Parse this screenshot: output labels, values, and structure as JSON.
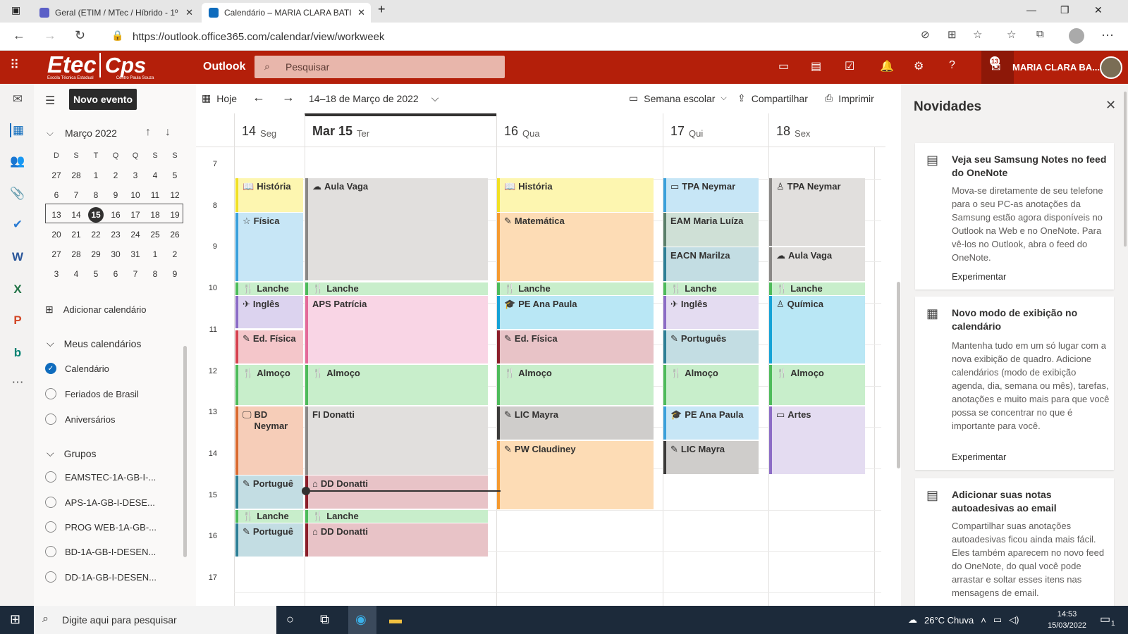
{
  "browser": {
    "tabs": [
      {
        "label": "Geral (ETIM / MTec / Híbrido - 1º",
        "active": false
      },
      {
        "label": "Calendário – MARIA CLARA BATI",
        "active": true
      }
    ],
    "url": "https://outlook.office365.com/calendar/view/workweek"
  },
  "app": {
    "name": "Outlook",
    "logo_text": "Etec",
    "logo_sub": "Escola Técnica Estadual",
    "logo_cps": "Cps",
    "logo_cps_sub": "Centro Paula Souza",
    "search_placeholder": "Pesquisar",
    "user_name": "MARIA CLARA BA...",
    "notif_count": "13"
  },
  "left": {
    "new_event": "Novo evento",
    "month_title": "Março 2022",
    "weekday_headers": [
      "D",
      "S",
      "T",
      "Q",
      "Q",
      "S",
      "S"
    ],
    "weeks": [
      [
        "27",
        "28",
        "1",
        "2",
        "3",
        "4",
        "5"
      ],
      [
        "6",
        "7",
        "8",
        "9",
        "10",
        "11",
        "12"
      ],
      [
        "13",
        "14",
        "15",
        "16",
        "17",
        "18",
        "19"
      ],
      [
        "20",
        "21",
        "22",
        "23",
        "24",
        "25",
        "26"
      ],
      [
        "27",
        "28",
        "29",
        "30",
        "31",
        "1",
        "2"
      ],
      [
        "3",
        "4",
        "5",
        "6",
        "7",
        "8",
        "9"
      ]
    ],
    "today": "15",
    "add_calendar": "Adicionar calendário",
    "my_calendars": "Meus calendários",
    "calendars": [
      "Calendário",
      "Feriados de Brasil",
      "Aniversários"
    ],
    "groups_label": "Grupos",
    "groups": [
      "EAMSTEC-1A-GB-I-...",
      "APS-1A-GB-I-DESE...",
      "PROG WEB-1A-GB-...",
      "BD-1A-GB-I-DESEN...",
      "DD-1A-GB-I-DESEN..."
    ]
  },
  "toolbar": {
    "today": "Hoje",
    "range": "14–18 de Março de 2022",
    "view": "Semana escolar",
    "share": "Compartilhar",
    "print": "Imprimir"
  },
  "days": [
    {
      "num": "14",
      "name": "Seg"
    },
    {
      "num": "Mar 15",
      "name": "Ter"
    },
    {
      "num": "16",
      "name": "Qua"
    },
    {
      "num": "17",
      "name": "Qui"
    },
    {
      "num": "18",
      "name": "Sex"
    }
  ],
  "hours": [
    "7",
    "8",
    "9",
    "10",
    "11",
    "12",
    "13",
    "14",
    "15",
    "16",
    "17"
  ],
  "events": {
    "mon": [
      {
        "title": "História",
        "icon": "📖"
      },
      {
        "title": "Física",
        "icon": "☆"
      },
      {
        "title": "Lanche",
        "icon": "🍴"
      },
      {
        "title": "Inglês",
        "icon": "✈"
      },
      {
        "title": "Ed. Física",
        "icon": "✎"
      },
      {
        "title": "Almoço",
        "icon": "🍴"
      },
      {
        "title": "BD Neymar",
        "icon": "🖵"
      },
      {
        "title": "Portuguê",
        "icon": "✎"
      },
      {
        "title": "Lanche",
        "icon": "🍴"
      },
      {
        "title": "Portuguê",
        "icon": "✎"
      }
    ],
    "tue": [
      {
        "title": "Aula Vaga",
        "icon": "☁"
      },
      {
        "title": "Lanche",
        "icon": "🍴"
      },
      {
        "title": "APS Patrícia",
        "icon": ""
      },
      {
        "title": "Almoço",
        "icon": "🍴"
      },
      {
        "title": "FI Donatti",
        "icon": ""
      },
      {
        "title": "DD Donatti",
        "icon": "⌂"
      },
      {
        "title": "Lanche",
        "icon": "🍴"
      },
      {
        "title": "DD Donatti",
        "icon": "⌂"
      }
    ],
    "wed": [
      {
        "title": "História",
        "icon": "📖"
      },
      {
        "title": "Matemática",
        "icon": "✎"
      },
      {
        "title": "Lanche",
        "icon": "🍴"
      },
      {
        "title": "PE Ana Paula",
        "icon": "🎓"
      },
      {
        "title": "Ed. Física",
        "icon": "✎"
      },
      {
        "title": "Almoço",
        "icon": "🍴"
      },
      {
        "title": "LIC Mayra",
        "icon": "✎"
      },
      {
        "title": "PW Claudiney",
        "icon": "✎"
      }
    ],
    "thu": [
      {
        "title": "TPA Neymar",
        "icon": "▭"
      },
      {
        "title": "EAM Maria Luíza",
        "icon": ""
      },
      {
        "title": "EACN Marilza",
        "icon": ""
      },
      {
        "title": "Lanche",
        "icon": "🍴"
      },
      {
        "title": "Inglês",
        "icon": "✈"
      },
      {
        "title": "Português",
        "icon": "✎"
      },
      {
        "title": "Almoço",
        "icon": "🍴"
      },
      {
        "title": "PE Ana Paula",
        "icon": "🎓"
      },
      {
        "title": "LIC Mayra",
        "icon": "✎"
      }
    ],
    "fri": [
      {
        "title": "TPA Neymar",
        "icon": "♙"
      },
      {
        "title": "Aula Vaga",
        "icon": "☁"
      },
      {
        "title": "Lanche",
        "icon": "🍴"
      },
      {
        "title": "Química",
        "icon": "♙"
      },
      {
        "title": "Almoço",
        "icon": "🍴"
      },
      {
        "title": "Artes",
        "icon": "▭"
      }
    ]
  },
  "news": {
    "title": "Novidades",
    "cards": [
      {
        "title": "Veja seu Samsung Notes no feed do OneNote",
        "body": "Mova-se diretamente de seu telefone para o seu PC-as anotações da Samsung estão agora disponíveis no Outlook na Web e no OneNote. Para vê-los no Outlook, abra o feed do OneNote.",
        "link": "Experimentar"
      },
      {
        "title": "Novo modo de exibição no calendário",
        "body": "Mantenha tudo em um só lugar com a nova exibição de quadro. Adicione calendários (modo de exibição agenda, dia, semana ou mês), tarefas, anotações e muito mais para que você possa se concentrar no que é importante para você.",
        "link": "Experimentar"
      },
      {
        "title": "Adicionar suas notas autoadesivas ao email",
        "body": "Compartilhar suas anotações autoadesivas ficou ainda mais fácil. Eles também aparecem no novo feed do OneNote, do qual você pode arrastar e soltar esses itens nas mensagens de email.",
        "link": ""
      }
    ]
  },
  "taskbar": {
    "search": "Digite aqui para pesquisar",
    "weather": "26°C  Chuva",
    "time": "14:53",
    "date": "15/03/2022",
    "notif": "1"
  }
}
